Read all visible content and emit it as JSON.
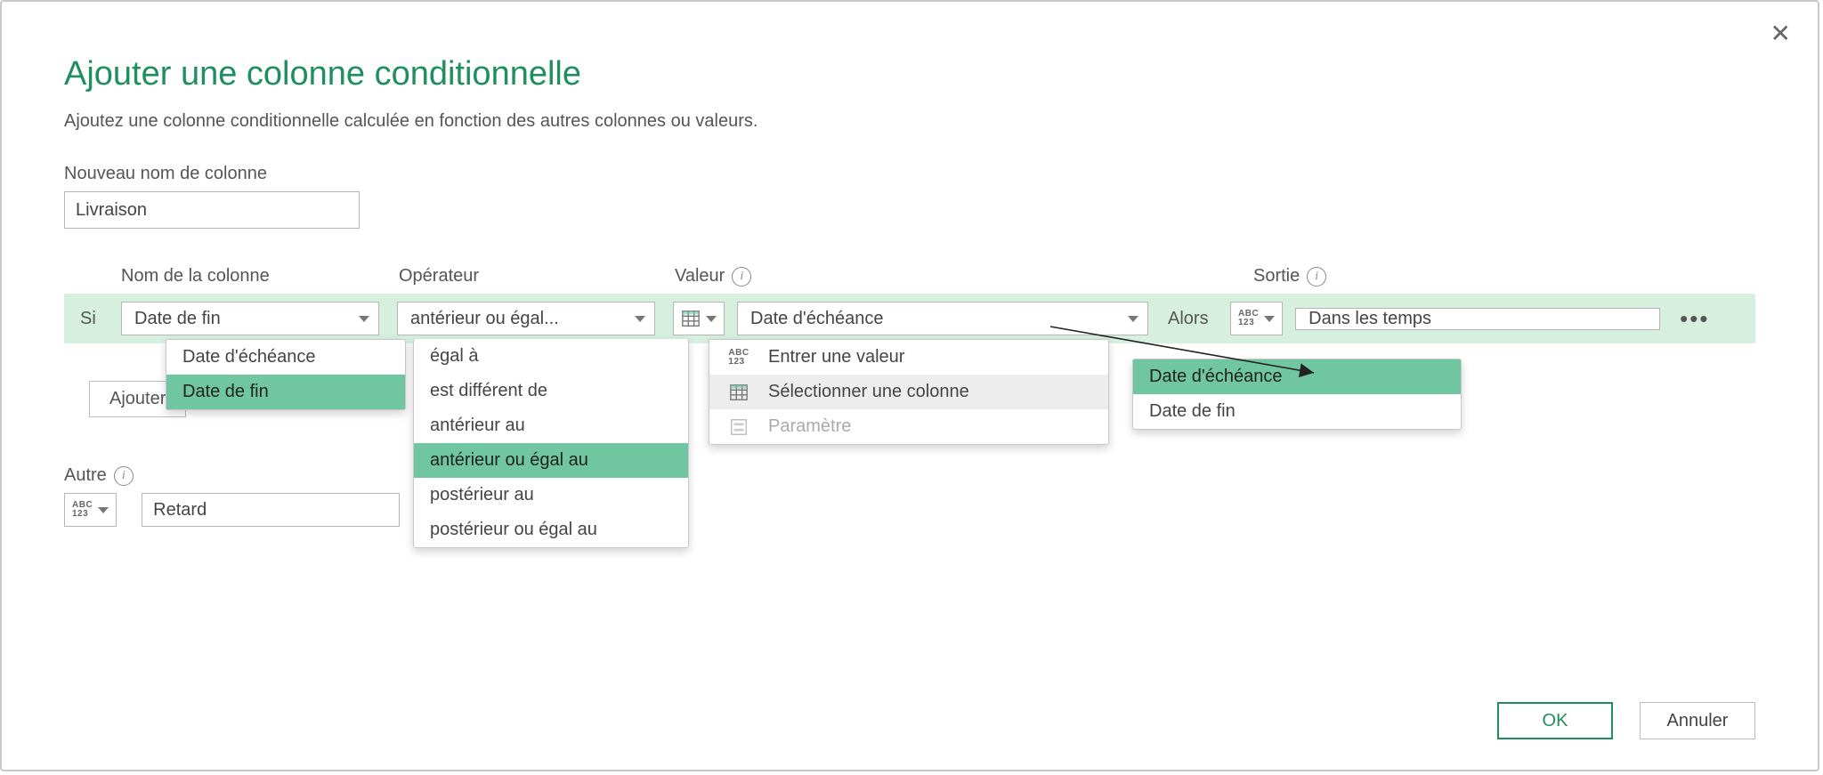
{
  "dialog": {
    "title": "Ajouter une colonne conditionnelle",
    "subtitle": "Ajoutez une colonne conditionnelle calculée en fonction des autres colonnes ou valeurs.",
    "new_col_label": "Nouveau nom de colonne",
    "new_col_value": "Livraison",
    "headers": {
      "column": "Nom de la colonne",
      "operator": "Opérateur",
      "value": "Valeur",
      "output": "Sortie"
    },
    "rule": {
      "if_label": "Si",
      "column_value": "Date de fin",
      "operator_value": "antérieur ou égal...",
      "value_value": "Date d'échéance",
      "then_label": "Alors",
      "output_value": "Dans les temps"
    },
    "add_clause_label": "Ajouter",
    "otherwise": {
      "label": "Autre",
      "value": "Retard"
    },
    "buttons": {
      "ok": "OK",
      "cancel": "Annuler"
    },
    "column_dropdown": {
      "items": [
        "Date d'échéance",
        "Date de fin"
      ],
      "selected": "Date de fin"
    },
    "operator_dropdown": {
      "items": [
        "égal à",
        "est différent de",
        "antérieur au",
        "antérieur ou égal au",
        "postérieur au",
        "postérieur ou égal au"
      ],
      "selected": "antérieur ou égal au"
    },
    "value_type_menu": {
      "items": [
        {
          "label": "Entrer une valeur",
          "icon": "abc123",
          "state": "normal"
        },
        {
          "label": "Sélectionner une colonne",
          "icon": "table",
          "state": "hover"
        },
        {
          "label": "Paramètre",
          "icon": "param",
          "state": "disabled"
        }
      ]
    },
    "value_column_menu": {
      "items": [
        "Date d'échéance",
        "Date de fin"
      ],
      "selected": "Date d'échéance"
    }
  }
}
